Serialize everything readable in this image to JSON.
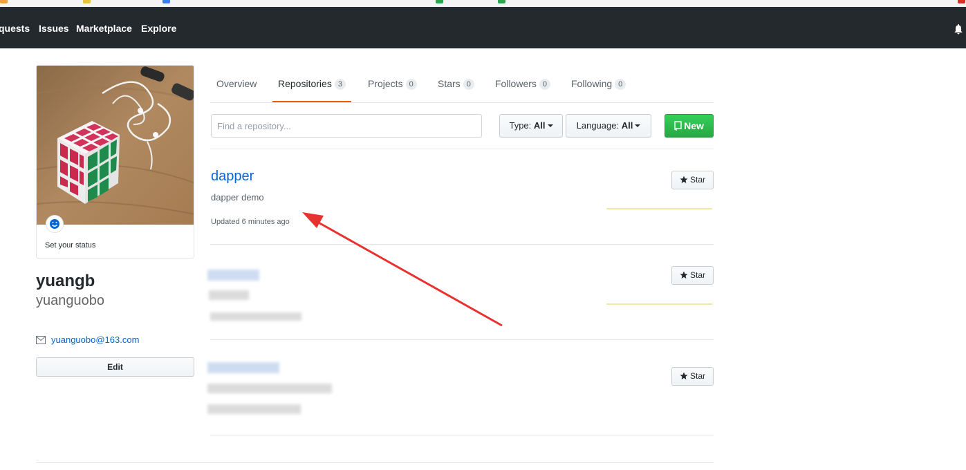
{
  "header": {
    "nav": [
      "quests",
      "Issues",
      "Marketplace",
      "Explore"
    ]
  },
  "profile": {
    "status_text": "Set your status",
    "fullname": "yuangb",
    "username": "yuanguobo",
    "email": "yuanguobo@163.com",
    "edit_label": "Edit"
  },
  "tabs": [
    {
      "label": "Overview",
      "count": ""
    },
    {
      "label": "Repositories",
      "count": "3"
    },
    {
      "label": "Projects",
      "count": "0"
    },
    {
      "label": "Stars",
      "count": "0"
    },
    {
      "label": "Followers",
      "count": "0"
    },
    {
      "label": "Following",
      "count": "0"
    }
  ],
  "filters": {
    "search_placeholder": "Find a repository...",
    "type_label": "Type:",
    "type_value": "All",
    "language_label": "Language:",
    "language_value": "All",
    "new_label": "New"
  },
  "repos": [
    {
      "name": "dapper",
      "description": "dapper demo",
      "updated": "Updated 6 minutes ago",
      "star_label": "Star"
    },
    {
      "name": "",
      "description": "",
      "updated": "",
      "star_label": "Star"
    },
    {
      "name": "",
      "description": "",
      "updated": "",
      "star_label": "Star"
    }
  ],
  "colors": {
    "header_bg": "#24292e",
    "link": "#0366d6",
    "tab_underline": "#e36209",
    "new_button": "#28a745",
    "annotation_arrow": "#e8322f"
  }
}
